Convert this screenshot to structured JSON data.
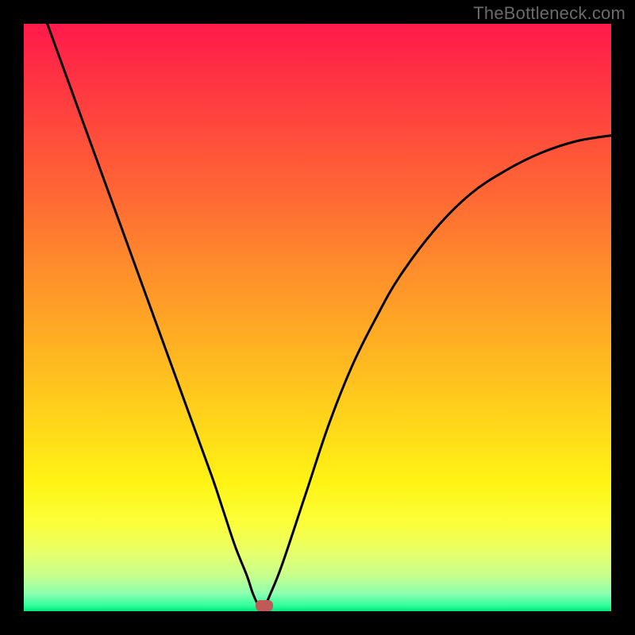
{
  "watermark": "TheBottleneck.com",
  "chart_data": {
    "type": "line",
    "title": "",
    "xlabel": "",
    "ylabel": "",
    "xlim": [
      0,
      100
    ],
    "ylim": [
      0,
      100
    ],
    "grid": false,
    "series": [
      {
        "name": "curve",
        "x": [
          4,
          8,
          12,
          16,
          20,
          24,
          28,
          32,
          34,
          36,
          38,
          39,
          40,
          41,
          42,
          44,
          48,
          52,
          56,
          60,
          64,
          70,
          76,
          82,
          88,
          94,
          100
        ],
        "y": [
          100,
          89,
          78,
          67,
          56,
          45,
          34,
          23,
          17,
          11,
          6,
          3,
          1,
          1,
          3,
          8,
          20,
          32,
          42,
          50,
          57,
          65,
          71,
          75,
          78,
          80,
          81
        ]
      }
    ],
    "marker": {
      "x": 41,
      "y": 1
    },
    "gradient_stops": [
      {
        "pos": 0,
        "color": "#ff1a4b"
      },
      {
        "pos": 50,
        "color": "#ff8e2b"
      },
      {
        "pos": 80,
        "color": "#fff314"
      },
      {
        "pos": 100,
        "color": "#00e878"
      }
    ]
  }
}
